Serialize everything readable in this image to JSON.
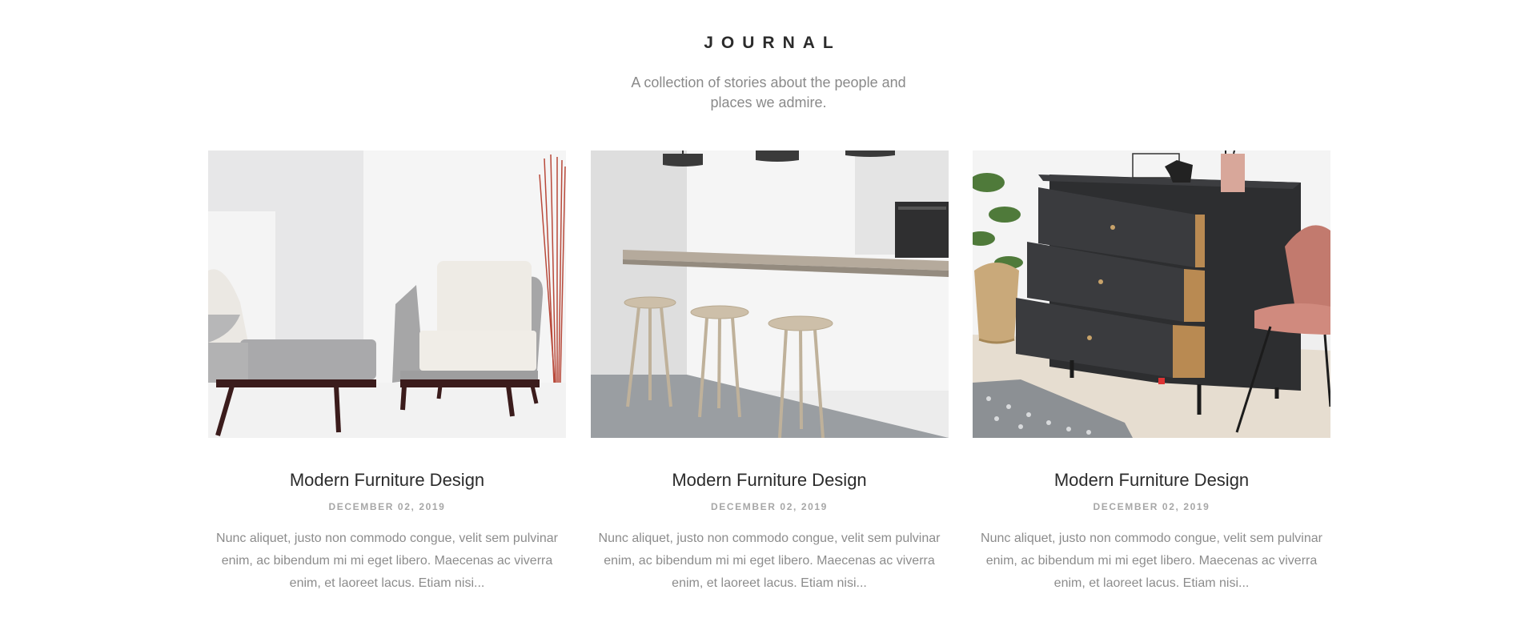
{
  "section": {
    "title": "JOURNAL",
    "subtitle": "A collection of stories about the people and places we admire."
  },
  "posts": [
    {
      "image": "armchairs-photo",
      "title": "Modern Furniture Design",
      "date": "DECEMBER 02, 2019",
      "excerpt": "Nunc aliquet, justo non commodo congue, velit sem pulvinar enim, ac bibendum mi mi eget libero. Maecenas ac viverra enim, et laoreet lacus. Etiam nisi..."
    },
    {
      "image": "bar-stools-photo",
      "title": "Modern Furniture Design",
      "date": "DECEMBER 02, 2019",
      "excerpt": "Nunc aliquet, justo non commodo congue, velit sem pulvinar enim, ac bibendum mi mi eget libero. Maecenas ac viverra enim, et laoreet lacus. Etiam nisi..."
    },
    {
      "image": "dresser-photo",
      "title": "Modern Furniture Design",
      "date": "DECEMBER 02, 2019",
      "excerpt": "Nunc aliquet, justo non commodo congue, velit sem pulvinar enim, ac bibendum mi mi eget libero. Maecenas ac viverra enim, et laoreet lacus. Etiam nisi..."
    }
  ]
}
